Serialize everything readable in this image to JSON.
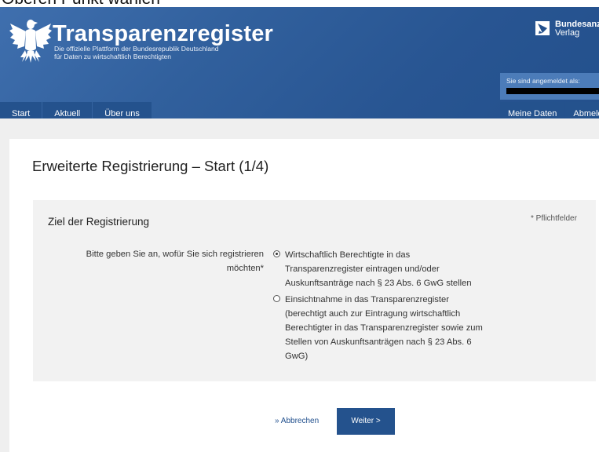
{
  "top_caption": "Oberen Punkt wählen",
  "header": {
    "title": "Transparenzregister",
    "subtitle_line1": "Die offizielle Plattform der Bundesrepublik Deutschland",
    "subtitle_line2": "für Daten zu wirtschaftlich Berechtigten",
    "publisher_name": "Bundesanzeiger",
    "publisher_sub": "Verlag",
    "login_label": "Sie sind angemeldet als:"
  },
  "nav": {
    "left": [
      "Start",
      "Aktuell",
      "Über uns"
    ],
    "right": [
      "Meine Daten",
      "Abmelden"
    ]
  },
  "main": {
    "heading": "Erweiterte Registrierung – Start (1/4)",
    "panel_title": "Ziel der Registrierung",
    "required_note": "* Pflichtfelder",
    "question": "Bitte geben Sie an, wofür Sie sich registrieren möchten*",
    "options": [
      {
        "label": "Wirtschaftlich Berechtigte in das Transparenzregister eintragen und/oder Auskunftsanträge nach § 23 Abs. 6 GwG stellen",
        "selected": true
      },
      {
        "label": "Einsichtnahme in das Transparenzregister (berechtigt auch zur Eintragung wirtschaftlich Berechtigter in das Transparenzregister sowie zum Stellen von Auskunftsanträgen nach § 23 Abs. 6 GwG)",
        "selected": false
      }
    ],
    "cancel_label": "» Abbrechen",
    "next_label": "Weiter >"
  },
  "colors": {
    "header_blue": "#31609d",
    "nav_blue": "#24528d",
    "panel_gray": "#f2f2f2",
    "link_blue": "#1f4e8c"
  },
  "icons": {
    "eagle": "federal-eagle-icon",
    "publisher_logo": "bundesanzeiger-logo-icon",
    "radio_checked": "radio-checked-icon",
    "radio_unchecked": "radio-unchecked-icon"
  }
}
